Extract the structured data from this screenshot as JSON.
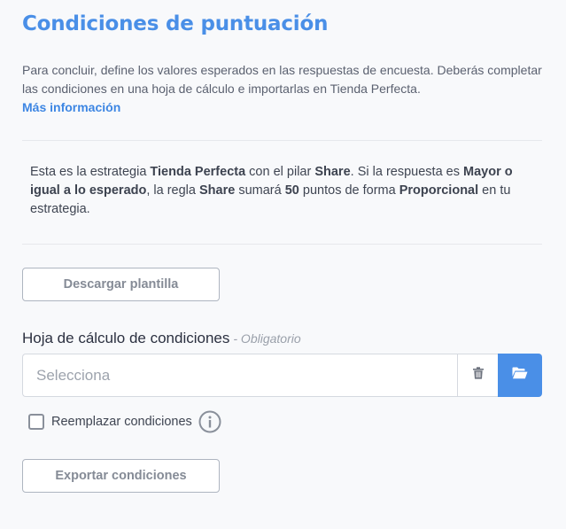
{
  "page": {
    "title": "Condiciones de puntuación",
    "intro_text": "Para concluir, define los valores esperados en las respuestas de encuesta. Deberás completar las condiciones en una hoja de cálculo e importarlas en Tienda Perfecta.",
    "more_info_link": "Más información"
  },
  "summary": {
    "t1": "Esta es la estrategia ",
    "strategy": "Tienda Perfecta",
    "t2": " con el pilar ",
    "pillar": "Share",
    "t3": ". Si la respuesta es ",
    "condition": "Mayor o igual a lo esperado",
    "t4": ", la regla ",
    "rule": "Share",
    "t5": " sumará ",
    "points": "50",
    "t6": " puntos de forma ",
    "mode": "Proporcional",
    "t7": " en tu estrategia."
  },
  "actions": {
    "download_template": "Descargar plantilla",
    "export_conditions": "Exportar condiciones"
  },
  "file_field": {
    "label": "Hoja de cálculo de condiciones",
    "required_hint": "- Obligatorio",
    "placeholder": "Selecciona",
    "delete_icon": "trash-icon",
    "browse_icon": "folder-open-icon"
  },
  "replace": {
    "label": "Reemplazar condiciones",
    "checked": false,
    "info_icon": "info-icon"
  },
  "colors": {
    "accent": "#4a8fe7",
    "link": "#3d86e3",
    "background": "#f8f9fb"
  }
}
